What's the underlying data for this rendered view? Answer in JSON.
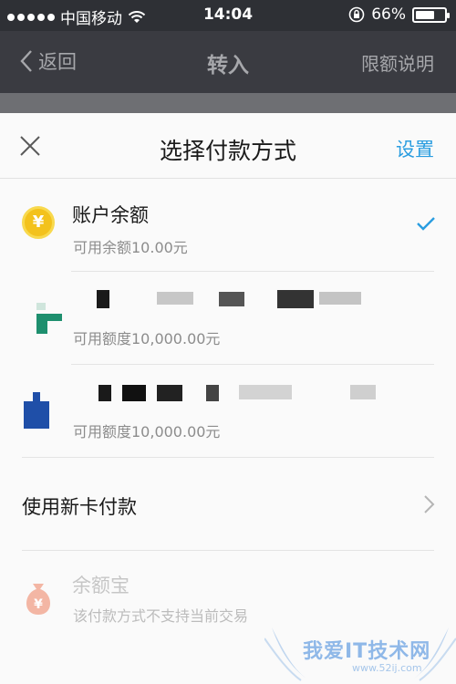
{
  "status_bar": {
    "carrier": "中国移动",
    "time": "14:04",
    "battery_percent": "66%",
    "battery_level": 0.66
  },
  "nav": {
    "back_label": "返回",
    "title": "转入",
    "right_label": "限额说明"
  },
  "sheet": {
    "title": "选择付款方式",
    "settings_label": "设置",
    "options": [
      {
        "title": "账户余额",
        "subtitle": "可用余额10.00元",
        "icon": "coin-icon",
        "selected": true
      },
      {
        "title": "",
        "subtitle": "可用额度10,000.00元",
        "icon": "bank-logo-icon",
        "selected": false
      },
      {
        "title": "",
        "subtitle": "可用额度10,000.00元",
        "icon": "bank-logo-icon",
        "selected": false
      }
    ],
    "new_card_label": "使用新卡付款",
    "disabled_option": {
      "title": "余额宝",
      "subtitle": "该付款方式不支持当前交易",
      "icon": "money-bag-icon"
    }
  },
  "watermark": {
    "text": "我爱IT技术网",
    "url": "www.52ij.com"
  },
  "colors": {
    "accent": "#2a9de0",
    "coin": "#f3c21c",
    "bank1": "#1e8f6e",
    "bank2": "#1f4fa8",
    "disabled_icon": "#f3b6a4"
  }
}
